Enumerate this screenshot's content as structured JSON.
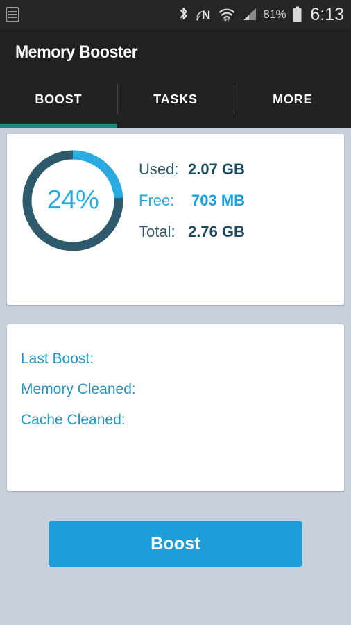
{
  "status_bar": {
    "notification_icon": "list-notification-icon",
    "icons": [
      "bluetooth-icon",
      "nfc-icon",
      "wifi-icon",
      "cellular-signal-icon"
    ],
    "battery_percent": "81%",
    "battery_icon": "battery-icon",
    "time": "6:13"
  },
  "header": {
    "title": "Memory Booster"
  },
  "tabs": [
    {
      "label": "BOOST",
      "active": true
    },
    {
      "label": "TASKS",
      "active": false
    },
    {
      "label": "MORE",
      "active": false
    }
  ],
  "memory_card": {
    "percent_label": "24%",
    "percent_value": 24,
    "stats": [
      {
        "key": "Used:",
        "value": "2.07 GB",
        "highlight": false
      },
      {
        "key": "Free:",
        "value": "703 MB",
        "highlight": true
      },
      {
        "key": "Total:",
        "value": "2.76 GB",
        "highlight": false
      }
    ]
  },
  "boost_info_card": {
    "rows": [
      {
        "key": "Last Boost:",
        "value": ""
      },
      {
        "key": "Memory Cleaned:",
        "value": ""
      },
      {
        "key": "Cache Cleaned:",
        "value": ""
      }
    ]
  },
  "boost_button": {
    "label": "Boost"
  },
  "colors": {
    "accent_blue": "#29abe2",
    "button_blue": "#1f9dd9",
    "ring_dark": "#2f5a6b",
    "tab_indicator": "#12897e",
    "page_background": "#c9cfdb",
    "bar_dark": "#212121"
  },
  "chart_data": {
    "type": "pie",
    "title": "Memory Usage",
    "categories": [
      "Used",
      "Free"
    ],
    "values": [
      24,
      76
    ],
    "value_labels": [
      "2.07 GB",
      "703 MB"
    ],
    "center_label": "24%",
    "total": "2.76 GB",
    "colors": [
      "#29abe2",
      "#2f5a6b"
    ],
    "legend": "right"
  }
}
